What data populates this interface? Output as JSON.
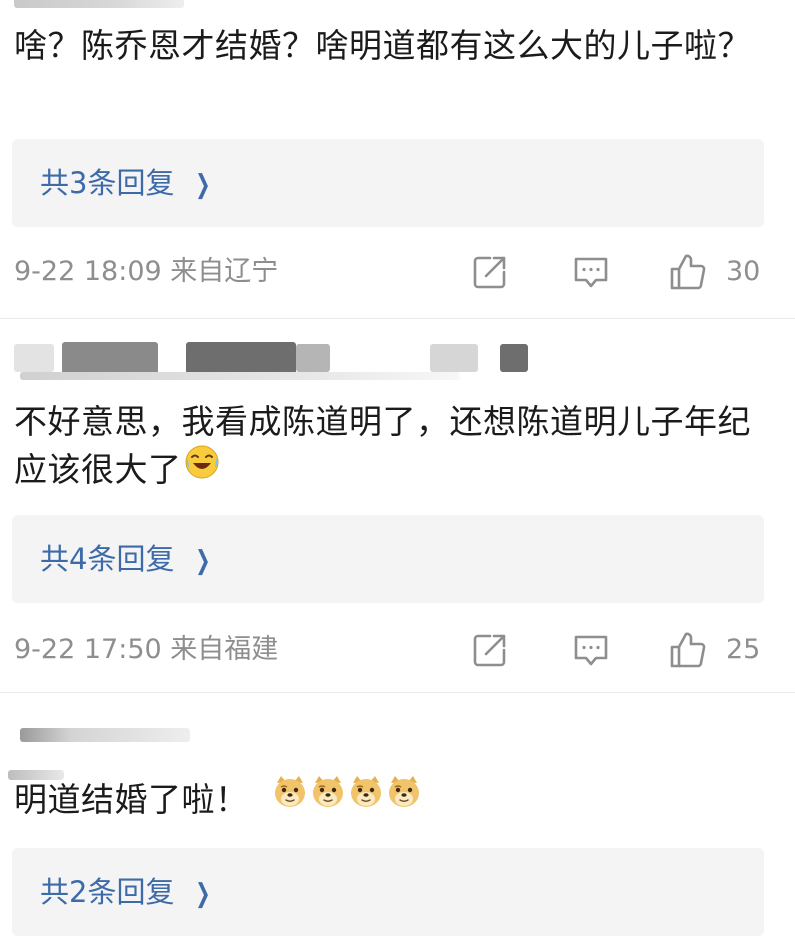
{
  "colors": {
    "link": "#3d6aa8",
    "meta": "#8e8e8e",
    "text": "#1b1b1b",
    "reply_bg": "#f4f4f4"
  },
  "comments": [
    {
      "text": "啥？陈乔恩才结婚？啥明道都有这么大的儿子啦？",
      "reply_label": "共3条回复",
      "time_location": "9-22 18:09 来自辽宁",
      "likes": "30"
    },
    {
      "text": "不好意思，我看成陈道明了，还想陈道明儿子年纪应该很大了",
      "emoji": "laugh-cry-emoji",
      "reply_label": "共4条回复",
      "time_location": "9-22 17:50 来自福建",
      "likes": "25"
    },
    {
      "text": "明道结婚了啦！",
      "emoji": "doge-emoji",
      "emoji_count": 4,
      "reply_label": "共2条回复"
    }
  ],
  "icons": {
    "share": "share-icon",
    "comment": "comment-icon",
    "like": "thumbs-up-icon",
    "chevron": "chevron-right-icon"
  }
}
